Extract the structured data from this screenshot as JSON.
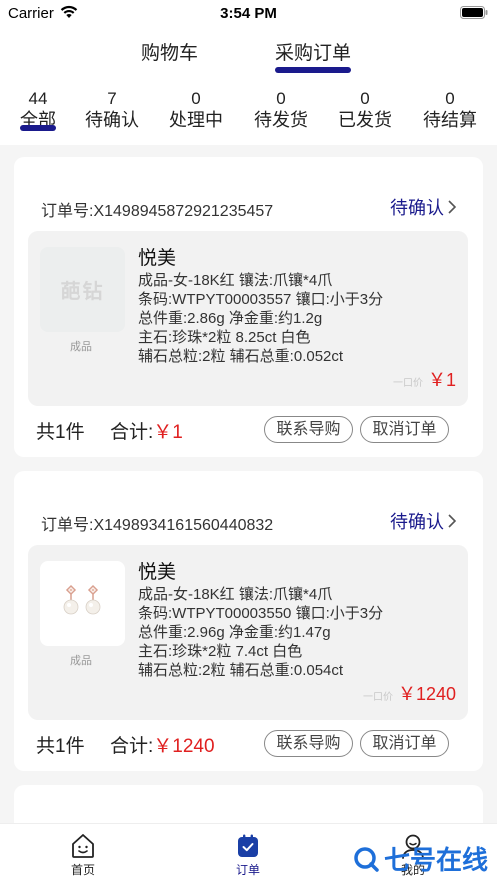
{
  "status_bar": {
    "carrier": "Carrier",
    "time": "3:54 PM"
  },
  "main_tabs": [
    {
      "label": "购物车",
      "active": false
    },
    {
      "label": "采购订单",
      "active": true
    }
  ],
  "status_tabs": [
    {
      "count": "44",
      "label": "全部",
      "active": true
    },
    {
      "count": "7",
      "label": "待确认",
      "active": false
    },
    {
      "count": "0",
      "label": "处理中",
      "active": false
    },
    {
      "count": "0",
      "label": "待发货",
      "active": false
    },
    {
      "count": "0",
      "label": "已发货",
      "active": false
    },
    {
      "count": "0",
      "label": "待结算",
      "active": false
    }
  ],
  "orders": [
    {
      "order_no": "订单号:X1498945872921235457",
      "status": "待确认",
      "thumb_placeholder": "葩钻",
      "product_type": "成品",
      "product_name": "悦美",
      "specs": [
        "成品-女-18K红  镶法:爪镶*4爪",
        "条码:WTPYT00003557  镶口:小于3分",
        "总件重:2.86g  净金重:约1.2g",
        "主石:珍珠*2粒  8.25ct  白色",
        "辅石总粒:2粒  辅石总重:0.052ct"
      ],
      "price_label": "一口价",
      "price": "￥1",
      "qty": "共1件",
      "total_label": "合计:",
      "total": "￥1",
      "btn_contact": "联系导购",
      "btn_cancel": "取消订单"
    },
    {
      "order_no": "订单号:X1498934161560440832",
      "status": "待确认",
      "thumb_placeholder": "",
      "product_type": "成品",
      "product_name": "悦美",
      "specs": [
        "成品-女-18K红  镶法:爪镶*4爪",
        "条码:WTPYT00003550  镶口:小于3分",
        "总件重:2.96g  净金重:约1.47g",
        "主石:珍珠*2粒  7.4ct  白色",
        "辅石总粒:2粒  辅石总重:0.054ct"
      ],
      "price_label": "一口价",
      "price": "￥1240",
      "qty": "共1件",
      "total_label": "合计:",
      "total": "￥1240",
      "btn_contact": "联系导购",
      "btn_cancel": "取消订单"
    }
  ],
  "bottom_nav": [
    {
      "label": "首页",
      "icon": "home-icon",
      "active": false
    },
    {
      "label": "订单",
      "icon": "order-icon",
      "active": true
    },
    {
      "label": "我的",
      "icon": "profile-icon",
      "active": false
    }
  ],
  "watermark": "七号在线",
  "colors": {
    "accent": "#1a1a8c",
    "price": "#e02020",
    "background": "#f5f5f5"
  }
}
